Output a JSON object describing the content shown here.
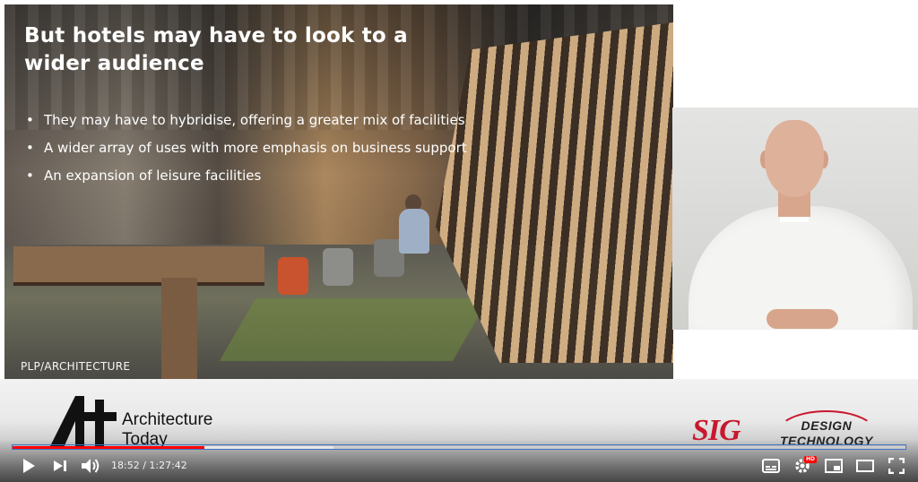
{
  "slide": {
    "title": "But hotels may have to look to a wider audience",
    "bullets": [
      "They may have to hybridise, offering a greater mix of facilities",
      "A wider array of uses with more emphasis on business support",
      "An expansion of leisure facilities"
    ],
    "credit": "PLP/ARCHITECTURE"
  },
  "branding": {
    "architecture_today_line1": "Architecture",
    "architecture_today_line2": "Today",
    "sig_logo": "SIG",
    "design_technology_line1": "DESIGN",
    "design_technology_line2": "TECHNOLOGY"
  },
  "player": {
    "time_display": "18:52 / 1:27:42",
    "played_fraction": 0.2151,
    "loaded_fraction": 0.36,
    "hd_badge": "HD",
    "colors": {
      "played": "#ff0000",
      "focus_outline": "#3f74c9"
    },
    "icons": [
      "play-icon",
      "next-icon",
      "volume-icon",
      "subtitles-icon",
      "settings-icon",
      "miniplayer-icon",
      "theater-mode-icon",
      "fullscreen-icon"
    ]
  }
}
